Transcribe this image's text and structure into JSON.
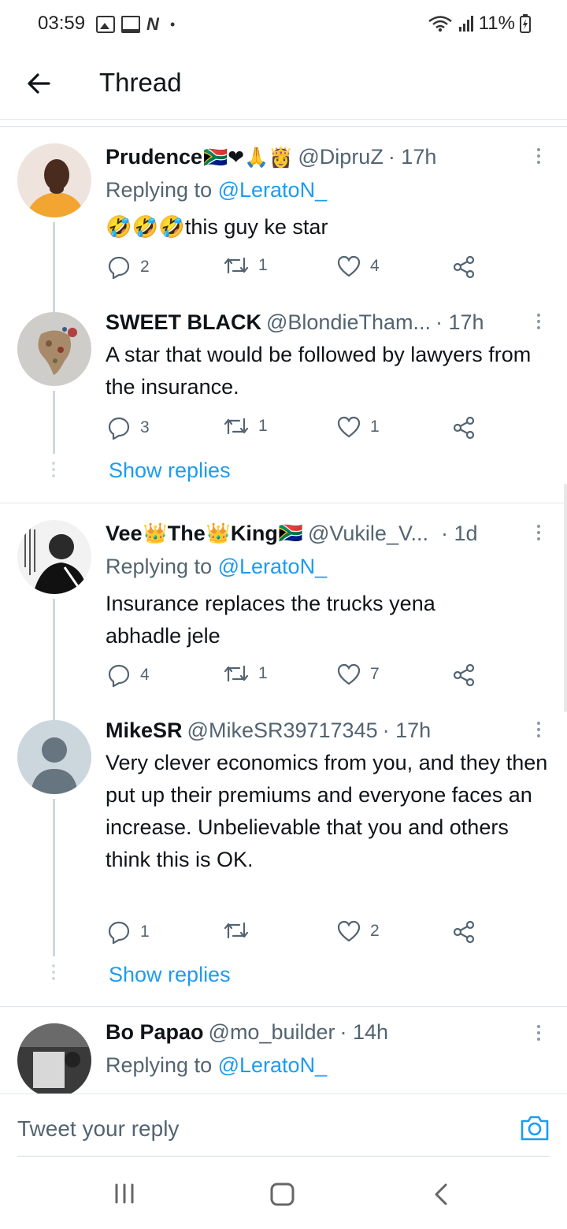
{
  "status": {
    "time": "03:59",
    "battery": "11%"
  },
  "header": {
    "title": "Thread"
  },
  "tweets": [
    {
      "name": "Prudence",
      "emojis": "🇿🇦❤🙏👸",
      "handle": "@DipruZ",
      "time": "· 17h",
      "replying_prefix": "Replying to",
      "replying_to": "@LeratoN_",
      "body": "🤣🤣🤣this guy ke star",
      "replies": "2",
      "retweets": "1",
      "likes": "4"
    },
    {
      "name": "SWEET BLACK",
      "emojis": "",
      "handle": "@BlondieTham...",
      "time": "· 17h",
      "body": "A star that would be followed by lawyers from the insurance.",
      "replies": "3",
      "retweets": "1",
      "likes": "1",
      "show_replies": "Show replies"
    },
    {
      "name": "Vee",
      "name_mid": "The",
      "name_end": "King",
      "crown": "👑",
      "flag": "🇿🇦",
      "handle": "@Vukile_V...",
      "time": "· 1d",
      "replying_prefix": "Replying to",
      "replying_to": "@LeratoN_",
      "body": "Insurance replaces the  trucks yena abhadle jele",
      "replies": "4",
      "retweets": "1",
      "likes": "7"
    },
    {
      "name": "MikeSR",
      "handle": "@MikeSR39717345",
      "time": "· 17h",
      "body": "Very clever economics from you, and they then put up their premiums and everyone faces an increase. Unbelievable that you and others think this is OK.",
      "replies": "1",
      "retweets": "",
      "likes": "2",
      "show_replies": "Show replies"
    },
    {
      "name": "Bo Papao",
      "handle": "@mo_builder",
      "time": "· 14h",
      "replying_prefix": "Replying to",
      "replying_to": "@LeratoN_"
    }
  ],
  "composer": {
    "placeholder": "Tweet your reply"
  },
  "colors": {
    "accent": "#1d9bf0",
    "muted": "#536471"
  }
}
